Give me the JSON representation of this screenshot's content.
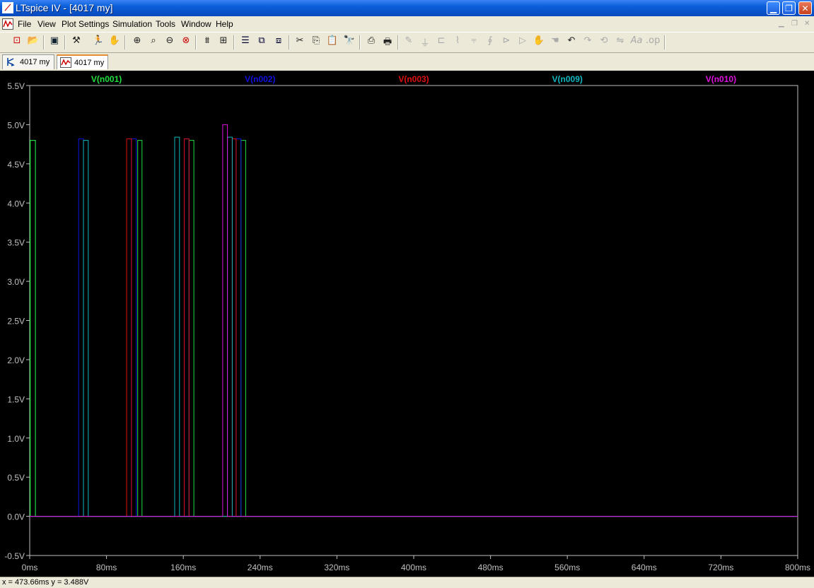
{
  "window": {
    "title": "LTspice IV - [4017 my]",
    "buttons": [
      "minimize",
      "restore",
      "close"
    ]
  },
  "menu": {
    "file": "File",
    "view": "View",
    "plot_settings": "Plot Settings",
    "simulation": "Simulation",
    "tools": "Tools",
    "window": "Window",
    "help": "Help"
  },
  "toolbar": {
    "icons": [
      "new-schematic-icon",
      "open-icon",
      "save-icon",
      "control-panel-icon",
      "run-icon",
      "pan-icon",
      "zoom-in-icon",
      "zoom-area-icon",
      "zoom-out-icon",
      "zoom-fit-icon",
      "autorange-icon",
      "plot-settings-icon",
      "tile-horizontal-icon",
      "cascade-icon",
      "tile-icon",
      "cut-icon",
      "copy-icon",
      "paste-icon",
      "find-icon",
      "print-preview-icon",
      "print-icon",
      "wire-icon",
      "ground-icon",
      "label-icon",
      "resistor-icon",
      "capacitor-icon",
      "inductor-icon",
      "diode-icon",
      "component-icon",
      "move-icon",
      "drag-icon",
      "undo-icon",
      "redo-icon",
      "rotate-icon",
      "mirror-icon",
      "text-icon",
      "spice-directive-icon"
    ]
  },
  "tabs": [
    {
      "label": "4017 my",
      "icon": "schematic-icon",
      "active": false
    },
    {
      "label": "4017 my",
      "icon": "waveform-icon",
      "active": true
    }
  ],
  "status": {
    "coords": "x = 473.66ms   y = 3.488V"
  },
  "colors": {
    "background": "#000000",
    "axis": "#c0c0c0",
    "grid_text": "#c0c0c0",
    "n001": "#20e040",
    "n002": "#1010e0",
    "n003": "#e01010",
    "n009": "#10b8c0",
    "n010": "#e010e0"
  },
  "chart_data": {
    "type": "line",
    "title": "",
    "xlabel": "",
    "ylabel": "",
    "xlim": [
      0,
      800
    ],
    "ylim": [
      -0.5,
      5.5
    ],
    "x_ticks": [
      "0ms",
      "80ms",
      "160ms",
      "240ms",
      "320ms",
      "400ms",
      "480ms",
      "560ms",
      "640ms",
      "720ms",
      "800ms"
    ],
    "y_ticks": [
      "5.5V",
      "5.0V",
      "4.5V",
      "4.0V",
      "3.5V",
      "3.0V",
      "2.5V",
      "2.0V",
      "1.5V",
      "1.0V",
      "0.5V",
      "0.0V",
      "-0.5V"
    ],
    "grid": false,
    "legend": "top",
    "series": [
      {
        "name": "V(n001)",
        "color": "#20e040",
        "x": [
          0,
          0.5,
          0.5,
          6,
          6,
          55.5,
          55.5,
          61,
          61,
          105.5,
          105.5,
          111,
          111,
          155.5,
          155.5,
          161,
          161,
          205.5,
          205.5,
          211,
          211,
          800
        ],
        "y": [
          0,
          0,
          4.8,
          4.8,
          0,
          0,
          0,
          0,
          0,
          0,
          0,
          0,
          0,
          0,
          0,
          0,
          0,
          0,
          0,
          0,
          0,
          0
        ]
      },
      {
        "name": "V(n001)",
        "color": "#20e040",
        "x": [
          0,
          58,
          58,
          62,
          62,
          800
        ],
        "y": [
          0,
          0,
          0,
          0,
          0,
          0
        ]
      },
      {
        "name": "V(n001)",
        "color": "#20e040",
        "x": [
          0,
          0.5,
          0.5,
          6,
          6,
          57.5,
          57.5,
          61.5,
          61.5,
          112.5,
          112.5,
          117,
          117,
          166,
          166,
          171,
          171,
          220,
          220,
          225,
          225,
          800
        ],
        "y": [
          0,
          0,
          4.8,
          4.8,
          0,
          0,
          0,
          0,
          0,
          0,
          4.8,
          4.8,
          0,
          0,
          4.8,
          4.8,
          0,
          0,
          4.8,
          4.8,
          0,
          0
        ]
      },
      {
        "name": "V(n002)",
        "color": "#1010e0",
        "x": [
          0,
          51,
          51,
          56,
          56,
          106,
          106,
          111,
          111,
          161,
          161,
          166,
          166,
          215,
          215,
          220,
          220,
          800
        ],
        "y": [
          0,
          0,
          4.82,
          4.82,
          0,
          0,
          4.82,
          4.82,
          0,
          0,
          4.82,
          4.82,
          0,
          0,
          4.82,
          4.82,
          0,
          0
        ]
      },
      {
        "name": "V(n003)",
        "color": "#e01010",
        "x": [
          0,
          101,
          101,
          106,
          106,
          161,
          161,
          166,
          166,
          211,
          211,
          215,
          215,
          800
        ],
        "y": [
          0,
          0,
          4.82,
          4.82,
          0,
          0,
          4.82,
          4.82,
          0,
          0,
          4.82,
          4.82,
          0,
          0
        ]
      },
      {
        "name": "V(n009)",
        "color": "#10b8c0",
        "x": [
          0,
          56,
          56,
          61,
          61,
          151,
          151,
          156,
          156,
          206,
          206,
          211,
          211,
          800
        ],
        "y": [
          0,
          0,
          4.8,
          4.8,
          0,
          0,
          4.84,
          4.84,
          0,
          0,
          4.84,
          4.84,
          0,
          0
        ]
      },
      {
        "name": "V(n010)",
        "color": "#e010e0",
        "x": [
          0,
          201,
          201,
          206,
          206,
          800
        ],
        "y": [
          0,
          0,
          5.0,
          5.0,
          0,
          0
        ]
      }
    ],
    "legend_entries": [
      {
        "name": "V(n001)",
        "color": "#20e040"
      },
      {
        "name": "V(n002)",
        "color": "#1010e0"
      },
      {
        "name": "V(n003)",
        "color": "#e01010"
      },
      {
        "name": "V(n009)",
        "color": "#10b8c0"
      },
      {
        "name": "V(n010)",
        "color": "#e010e0"
      }
    ]
  }
}
